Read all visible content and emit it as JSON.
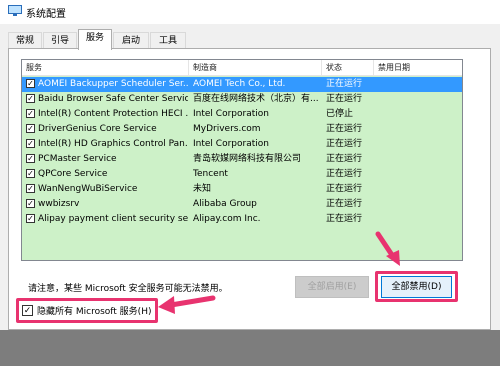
{
  "window": {
    "title": "系统配置"
  },
  "tabs": [
    {
      "label": "常规",
      "active": false
    },
    {
      "label": "引导",
      "active": false
    },
    {
      "label": "服务",
      "active": true
    },
    {
      "label": "启动",
      "active": false
    },
    {
      "label": "工具",
      "active": false
    }
  ],
  "table": {
    "headers": [
      "服务",
      "制造商",
      "状态",
      "禁用日期"
    ],
    "rows": [
      {
        "checked": true,
        "service": "AOMEI Backupper Scheduler Ser...",
        "manufacturer": "AOMEI Tech Co., Ltd.",
        "status": "正在运行",
        "disabled_date": "",
        "selected": true
      },
      {
        "checked": true,
        "service": "Baidu Browser Safe Center Service",
        "manufacturer": "百度在线网络技术（北京）有...",
        "status": "正在运行",
        "disabled_date": ""
      },
      {
        "checked": true,
        "service": "Intel(R) Content Protection HECI ...",
        "manufacturer": "Intel Corporation",
        "status": "已停止",
        "disabled_date": ""
      },
      {
        "checked": true,
        "service": "DriverGenius Core Service",
        "manufacturer": "MyDrivers.com",
        "status": "正在运行",
        "disabled_date": ""
      },
      {
        "checked": true,
        "service": "Intel(R) HD Graphics Control Pan...",
        "manufacturer": "Intel Corporation",
        "status": "正在运行",
        "disabled_date": ""
      },
      {
        "checked": true,
        "service": "PCMaster Service",
        "manufacturer": "青岛软媒网络科技有限公司",
        "status": "正在运行",
        "disabled_date": ""
      },
      {
        "checked": true,
        "service": "QPCore Service",
        "manufacturer": "Tencent",
        "status": "正在运行",
        "disabled_date": ""
      },
      {
        "checked": true,
        "service": "WanNengWuBiService",
        "manufacturer": "未知",
        "status": "正在运行",
        "disabled_date": ""
      },
      {
        "checked": true,
        "service": "wwbizsrv",
        "manufacturer": "Alibaba Group",
        "status": "正在运行",
        "disabled_date": ""
      },
      {
        "checked": true,
        "service": "Alipay payment client security ser...",
        "manufacturer": "Alipay.com Inc.",
        "status": "正在运行",
        "disabled_date": ""
      }
    ]
  },
  "note": "请注意，某些 Microsoft 安全服务可能无法禁用。",
  "buttons": {
    "enable_all": "全部启用(E)",
    "disable_all": "全部禁用(D)"
  },
  "hide_ms": {
    "label": "隐藏所有 Microsoft 服务(H)",
    "checked": true
  },
  "colors": {
    "highlight": "#e8336f",
    "selection": "#3399ff",
    "row_background": "#cdf1c8"
  }
}
